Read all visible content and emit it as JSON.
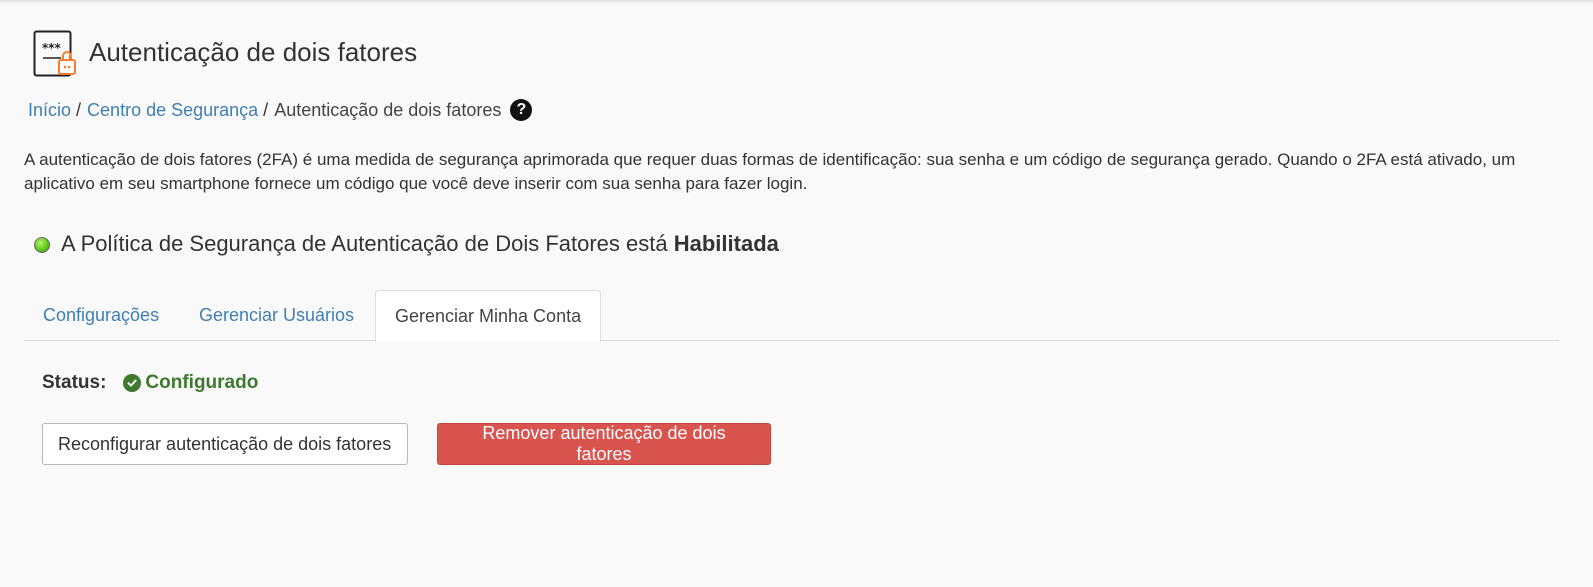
{
  "header": {
    "title": "Autenticação de dois fatores",
    "icon": "two-factor-icon"
  },
  "breadcrumb": {
    "items": [
      {
        "label": "Início"
      },
      {
        "label": "Centro de Segurança"
      }
    ],
    "separator": "/",
    "current": "Autenticação de dois fatores",
    "help_symbol": "?"
  },
  "description": "A autenticação de dois fatores (2FA) é uma medida de segurança aprimorada que requer duas formas de identificação: sua senha e um código de segurança gerado. Quando o 2FA está ativado, um aplicativo em seu smartphone fornece um código que você deve inserir com sua senha para fazer login.",
  "policy": {
    "text": "A Política de Segurança de Autenticação de Dois Fatores está",
    "state": "Habilitada",
    "led_color": "#5ec91b"
  },
  "tabs": [
    {
      "label": "Configurações",
      "active": false
    },
    {
      "label": "Gerenciar Usuários",
      "active": false
    },
    {
      "label": "Gerenciar Minha Conta",
      "active": true
    }
  ],
  "status": {
    "label": "Status:",
    "value": "Configurado",
    "color": "#3d7a2f"
  },
  "buttons": {
    "reconfigure": "Reconfigurar autenticação de dois fatores",
    "remove": "Remover autenticação de dois fatores"
  },
  "colors": {
    "link": "#3f7fb4",
    "danger": "#d9534f",
    "background": "#f9f9f9"
  }
}
